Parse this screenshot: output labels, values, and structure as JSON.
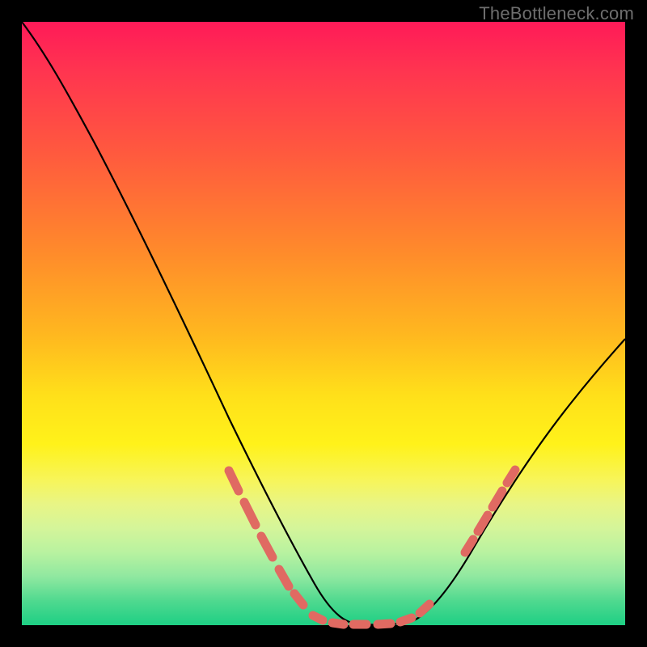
{
  "watermark": "TheBottleneck.com",
  "chart_data": {
    "type": "line",
    "title": "",
    "xlabel": "",
    "ylabel": "",
    "xlim": [
      0,
      100
    ],
    "ylim": [
      0,
      100
    ],
    "grid": false,
    "series": [
      {
        "name": "curve",
        "x": [
          0,
          5,
          10,
          15,
          20,
          25,
          30,
          35,
          40,
          45,
          48,
          50,
          53,
          57,
          60,
          63,
          66,
          70,
          75,
          80,
          85,
          90,
          95,
          100
        ],
        "values": [
          100,
          92,
          83,
          74,
          65,
          56,
          47,
          38,
          29,
          18,
          11,
          6,
          2,
          0,
          0,
          0,
          2,
          6,
          13,
          22,
          31,
          41,
          50,
          58
        ]
      }
    ],
    "markers": [
      {
        "name": "dash-cluster-left",
        "x_range": [
          34,
          48
        ],
        "y_range": [
          6,
          25
        ],
        "style": "salmon-pill"
      },
      {
        "name": "dash-cluster-floor",
        "x_range": [
          50,
          66
        ],
        "y_range": [
          0,
          2
        ],
        "style": "salmon-pill"
      },
      {
        "name": "dash-cluster-right",
        "x_range": [
          72,
          82
        ],
        "y_range": [
          10,
          25
        ],
        "style": "salmon-pill"
      }
    ],
    "background_gradient": {
      "top": "#ff1a58",
      "mid": "#ffe01a",
      "bottom": "#1ecf84"
    }
  }
}
